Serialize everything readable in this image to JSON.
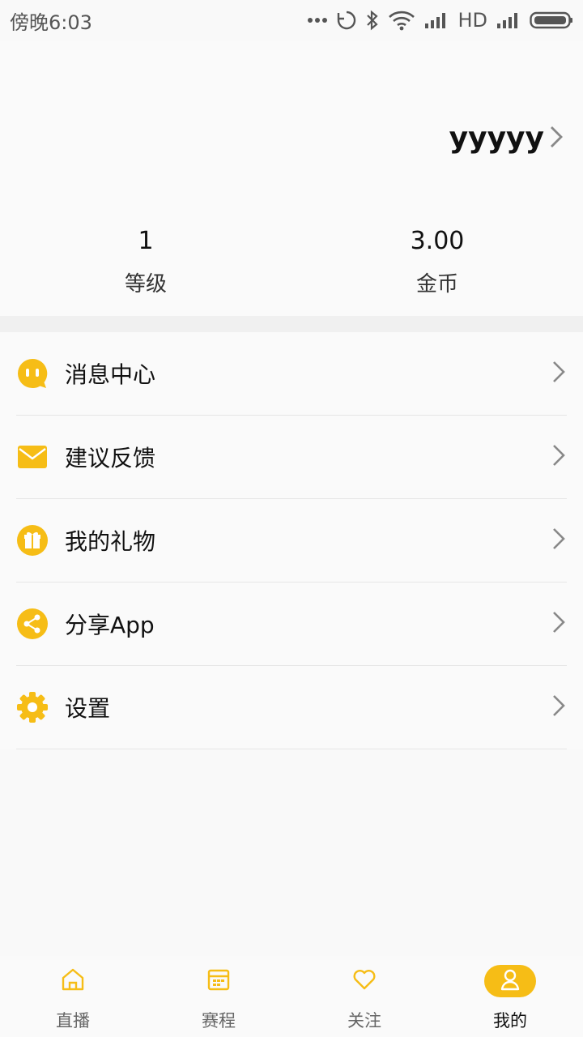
{
  "status_bar": {
    "time": "傍晚6:03",
    "network_label": "HD"
  },
  "profile": {
    "username": "yyyyy",
    "stats": [
      {
        "value": "1",
        "label": "等级"
      },
      {
        "value": "3.00",
        "label": "金币"
      }
    ]
  },
  "menu": {
    "items": [
      {
        "label": "消息中心",
        "icon": "message-icon"
      },
      {
        "label": "建议反馈",
        "icon": "mail-icon"
      },
      {
        "label": "我的礼物",
        "icon": "gift-icon"
      },
      {
        "label": "分享App",
        "icon": "share-icon"
      },
      {
        "label": "设置",
        "icon": "settings-gear-icon"
      }
    ]
  },
  "tabs": {
    "items": [
      {
        "label": "直播",
        "icon": "home-icon"
      },
      {
        "label": "赛程",
        "icon": "calendar-icon"
      },
      {
        "label": "关注",
        "icon": "heart-icon"
      },
      {
        "label": "我的",
        "icon": "user-icon"
      }
    ],
    "active": "我的"
  },
  "colors": {
    "accent": "#f6bd16",
    "background": "#f9f9f9"
  }
}
